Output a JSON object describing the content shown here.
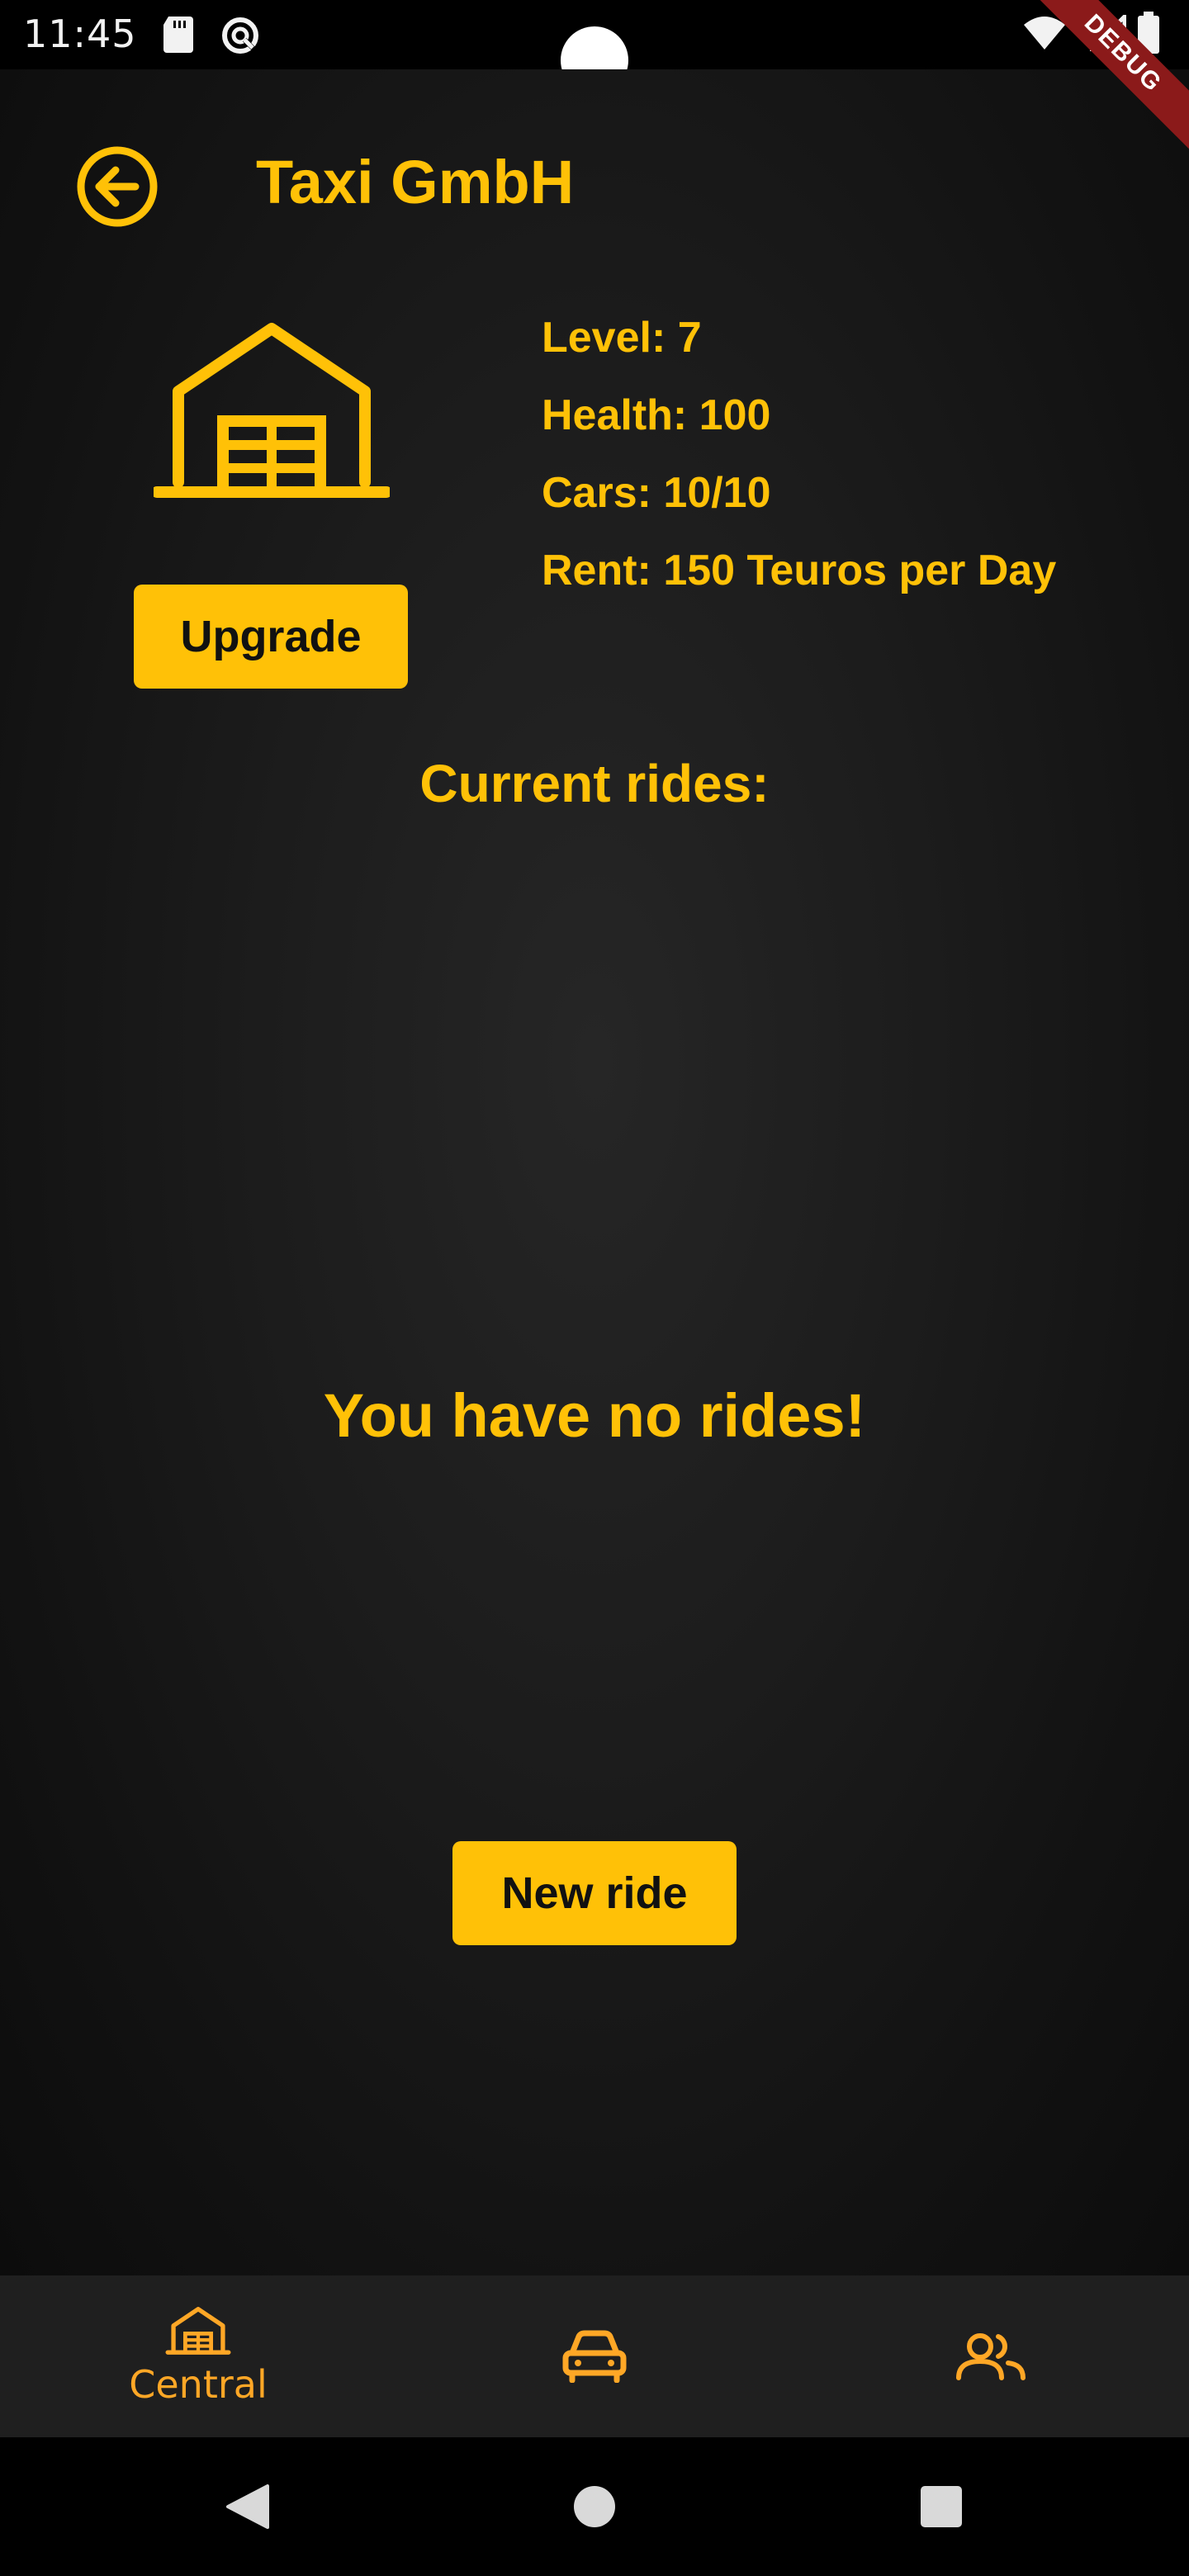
{
  "status_bar": {
    "time": "11:45",
    "debug_label": "DEBUG"
  },
  "header": {
    "title": "Taxi GmbH",
    "back_icon": "arrow-left-circle-icon"
  },
  "central": {
    "icon": "warehouse-icon",
    "upgrade_label": "Upgrade",
    "stats": {
      "level": "Level: 7",
      "health": "Health: 100",
      "cars": "Cars: 10/10",
      "rent": "Rent: 150 Teuros per Day"
    }
  },
  "rides": {
    "heading": "Current rides:",
    "empty_message": "You have no rides!",
    "new_ride_label": "New ride"
  },
  "bottom_nav": {
    "items": [
      {
        "icon": "warehouse-icon",
        "label": "Central",
        "selected": true
      },
      {
        "icon": "car-icon",
        "label": "",
        "selected": false
      },
      {
        "icon": "people-icon",
        "label": "",
        "selected": false
      }
    ]
  },
  "colors": {
    "accent": "#FFC107",
    "nav_accent": "#FFA726",
    "background": "#121212",
    "debug_banner": "#8B1A1A"
  }
}
